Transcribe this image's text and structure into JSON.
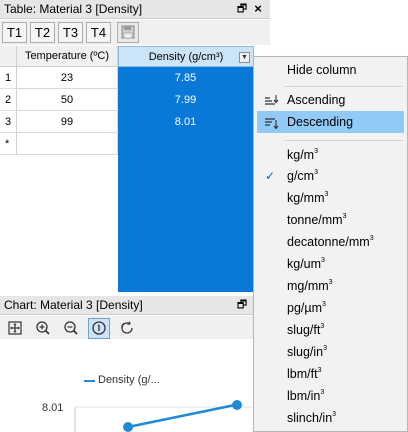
{
  "table_panel": {
    "title": "Table: Material 3 [Density]",
    "pin_glyph": "🗗",
    "close_glyph": "×"
  },
  "toolbar": {
    "buttons": [
      "T1",
      "T2",
      "T3",
      "T4"
    ]
  },
  "grid": {
    "columns": [
      "Temperature (ºC)",
      "Density (g/cm³)"
    ],
    "rows": [
      {
        "index": "1",
        "temperature": "23",
        "density": "7.85"
      },
      {
        "index": "2",
        "temperature": "50",
        "density": "7.99"
      },
      {
        "index": "3",
        "temperature": "99",
        "density": "8.01"
      }
    ],
    "new_row_marker": "*"
  },
  "chart_panel": {
    "title": "Chart: Material 3 [Density]",
    "legend_label": "Density (g/...",
    "y_tick_label": "8.01"
  },
  "context_menu": {
    "hide_column": "Hide column",
    "ascending": "Ascending",
    "descending": "Descending",
    "units": [
      {
        "base": "kg/m",
        "exp": "3",
        "checked": false
      },
      {
        "base": "g/cm",
        "exp": "3",
        "checked": true
      },
      {
        "base": "kg/mm",
        "exp": "3",
        "checked": false
      },
      {
        "base": "tonne/mm",
        "exp": "3",
        "checked": false
      },
      {
        "base": "decatonne/mm",
        "exp": "3",
        "checked": false
      },
      {
        "base": "kg/um",
        "exp": "3",
        "checked": false
      },
      {
        "base": "mg/mm",
        "exp": "3",
        "checked": false
      },
      {
        "base": "pg/µm",
        "exp": "3",
        "checked": false
      },
      {
        "base": "slug/ft",
        "exp": "3",
        "checked": false
      },
      {
        "base": "slug/in",
        "exp": "3",
        "checked": false
      },
      {
        "base": "lbm/ft",
        "exp": "3",
        "checked": false
      },
      {
        "base": "lbm/in",
        "exp": "3",
        "checked": false
      },
      {
        "base": "slinch/in",
        "exp": "3",
        "checked": false
      }
    ],
    "check_glyph": "✓"
  },
  "colors": {
    "selection": "#0a78d7",
    "highlight": "#91c9f7",
    "series_line": "#1f8bd8"
  }
}
